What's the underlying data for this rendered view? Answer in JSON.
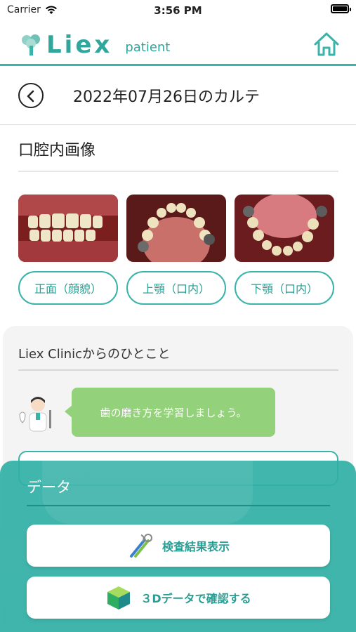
{
  "status_bar": {
    "carrier": "Carrier",
    "time": "3:56 PM"
  },
  "header": {
    "logo": "Liex",
    "sub": "patient"
  },
  "page": {
    "title": "2022年07月26日のカルテ"
  },
  "intraoral": {
    "title": "口腔内画像",
    "images": [
      {
        "label": "正面（顔貌）"
      },
      {
        "label": "上顎（口内）"
      },
      {
        "label": "下顎（口内）"
      }
    ]
  },
  "clinic": {
    "title": "Liex Clinicからのひとこと",
    "message": "歯の磨き方を学習しましょう。"
  },
  "data_sheet": {
    "title": "データ",
    "actions": [
      {
        "label": "検査結果表示",
        "icon": "dental-tools-icon"
      },
      {
        "label": "３Dデータで確認する",
        "icon": "cube-3d-icon"
      }
    ]
  },
  "colors": {
    "accent": "#3ab3a9",
    "bubble": "#93d27a"
  }
}
